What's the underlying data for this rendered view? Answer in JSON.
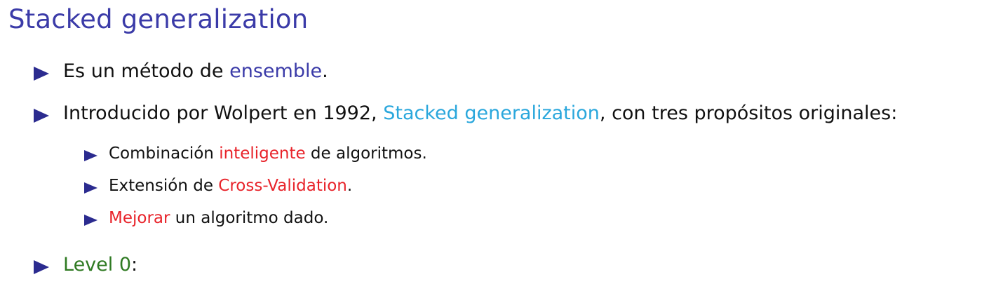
{
  "slide": {
    "title": "Stacked generalization",
    "bullet_color": "#2b2b8f",
    "colors": {
      "title": "#3b3ba8",
      "blue": "#3b3ba8",
      "cyan": "#2aa7dc",
      "red": "#e8232a",
      "green": "#2f7a22"
    },
    "items": [
      {
        "parts": [
          {
            "text": "Es un método de "
          },
          {
            "text": "ensemble",
            "color": "blue"
          },
          {
            "text": "."
          }
        ]
      },
      {
        "parts": [
          {
            "text": "Introducido por Wolpert en 1992, "
          },
          {
            "text": "Stacked generalization",
            "color": "cyan"
          },
          {
            "text": ", con tres propósitos originales:"
          }
        ],
        "subitems": [
          {
            "parts": [
              {
                "text": "Combinación "
              },
              {
                "text": "inteligente",
                "color": "red"
              },
              {
                "text": " de algoritmos."
              }
            ]
          },
          {
            "parts": [
              {
                "text": "Extensión de "
              },
              {
                "text": "Cross-Validation",
                "color": "red"
              },
              {
                "text": "."
              }
            ]
          },
          {
            "parts": [
              {
                "text": "Mejorar",
                "color": "red"
              },
              {
                "text": " un algoritmo dado."
              }
            ]
          }
        ]
      },
      {
        "parts": [
          {
            "text": "Level 0",
            "color": "green"
          },
          {
            "text": ":"
          }
        ]
      }
    ]
  }
}
